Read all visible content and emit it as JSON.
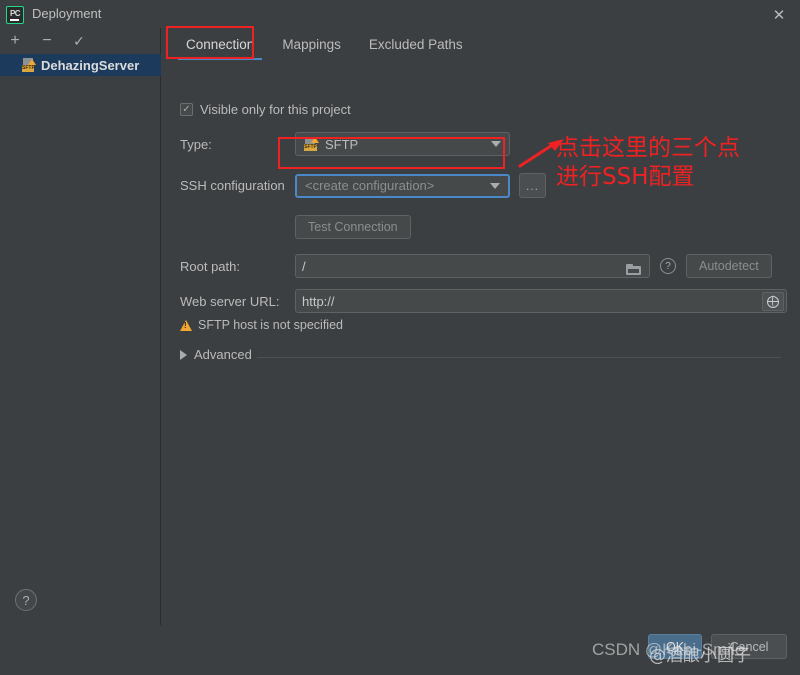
{
  "window": {
    "title": "Deployment",
    "app_icon": "pycharm-logo-icon",
    "close_icon": "✕"
  },
  "sidebar": {
    "toolbar": [
      {
        "name": "add-server-button",
        "glyph": "+"
      },
      {
        "name": "remove-server-button",
        "glyph": "−"
      },
      {
        "name": "set-default-server-button",
        "glyph": "✓"
      }
    ],
    "servers": [
      {
        "label": "DehazingServer",
        "icon": "sftp-server-icon",
        "tag": "SFTP",
        "selected": true
      }
    ],
    "help_glyph": "?"
  },
  "tabs": [
    {
      "label": "Connection",
      "active": true
    },
    {
      "label": "Mappings",
      "active": false
    },
    {
      "label": "Excluded Paths",
      "active": false
    }
  ],
  "form": {
    "visible_only_checkbox": {
      "label": "Visible only for this project",
      "checked": true,
      "check_glyph": "✓"
    },
    "type": {
      "label": "Type:",
      "value": "SFTP",
      "icon_tag": "SFTP"
    },
    "ssh_configuration": {
      "label": "SSH configuration",
      "value": "<create configuration>",
      "dots_button_label": "...",
      "focused": true
    },
    "test_connection_button": "Test Connection",
    "root_path": {
      "label": "Root path:",
      "value": "/",
      "browse_icon": "folder-icon",
      "help_icon": "?",
      "autodetect_button": "Autodetect"
    },
    "web_server_url": {
      "label": "Web server URL:",
      "value": "http://",
      "open_icon": "globe-icon"
    },
    "warning": {
      "icon": "warning-triangle-icon",
      "text": "SFTP host is not specified"
    },
    "advanced": {
      "label": "Advanced",
      "expanded": false,
      "arrow_icon": "chevron-right-icon"
    }
  },
  "footer": {
    "ok_button": "OK",
    "cancel_button": "Cancel"
  },
  "annotations": {
    "line1": "点击这里的三个点",
    "line2": "进行SSH配置",
    "color": "#ee2222"
  },
  "watermark": {
    "text": "CSDN @Kabi-Smile",
    "overlay_text": "@酒酿小圆子"
  }
}
